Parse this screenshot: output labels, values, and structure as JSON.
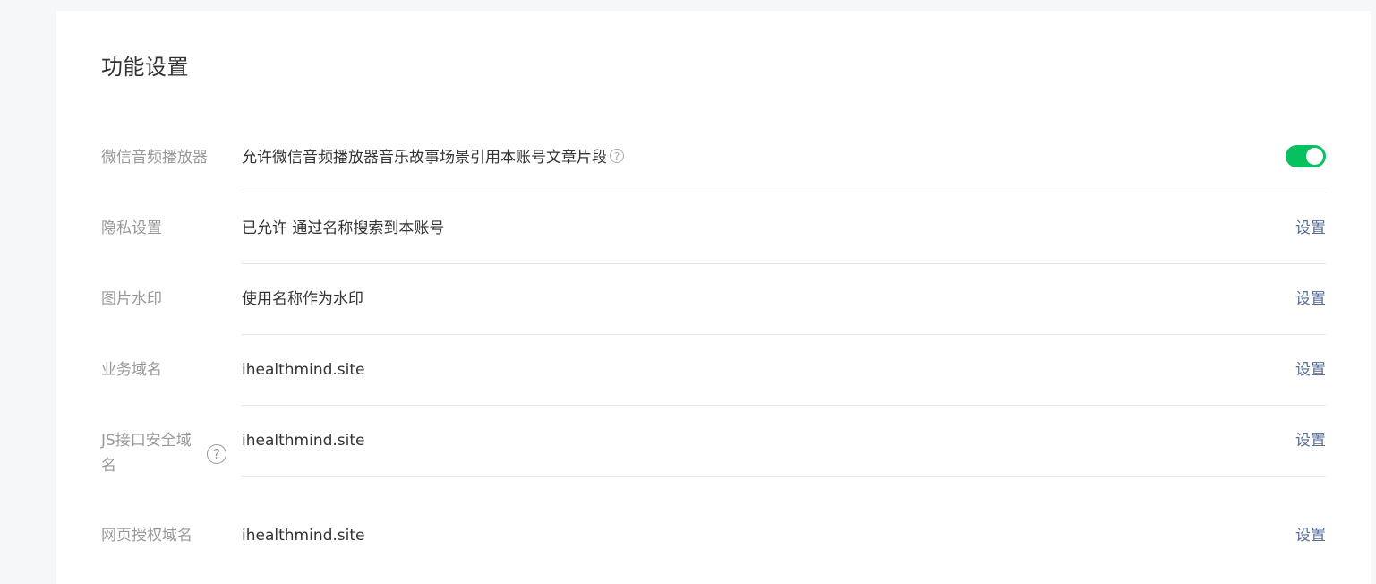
{
  "page": {
    "title": "功能设置"
  },
  "colors": {
    "toggle_on": "#07c160",
    "link": "#576b95",
    "label": "#999999",
    "text": "#333333",
    "divider": "#e7e7eb",
    "page_bg": "#f6f7f9"
  },
  "settings": [
    {
      "label": "微信音频播放器",
      "value": "允许微信音频播放器音乐故事场景引用本账号文章片段",
      "help_icon": "question-circle-icon",
      "control": "toggle",
      "toggle_state": "on"
    },
    {
      "label": "隐私设置",
      "value": "已允许 通过名称搜索到本账号",
      "action": "设置"
    },
    {
      "label": "图片水印",
      "value": "使用名称作为水印",
      "action": "设置"
    },
    {
      "label": "业务域名",
      "value": "ihealthmind.site",
      "action": "设置"
    },
    {
      "label": "JS接口安全域名",
      "value": "ihealthmind.site",
      "help_icon": "question-circle-icon",
      "action": "设置"
    },
    {
      "label": "网页授权域名",
      "value": "ihealthmind.site",
      "action": "设置"
    }
  ]
}
